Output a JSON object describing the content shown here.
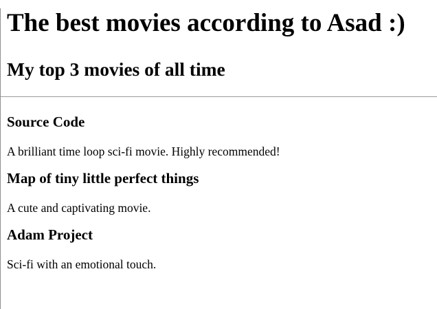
{
  "page": {
    "title": "The best movies according to Asad :)",
    "subtitle": "My top 3 movies of all time"
  },
  "movies": [
    {
      "name": "Source Code",
      "description": "A brilliant time loop sci-fi movie. Highly recommended!"
    },
    {
      "name": "Map of tiny little perfect things",
      "description": "A cute and captivating movie."
    },
    {
      "name": "Adam Project",
      "description": "Sci-fi with an emotional touch."
    }
  ]
}
